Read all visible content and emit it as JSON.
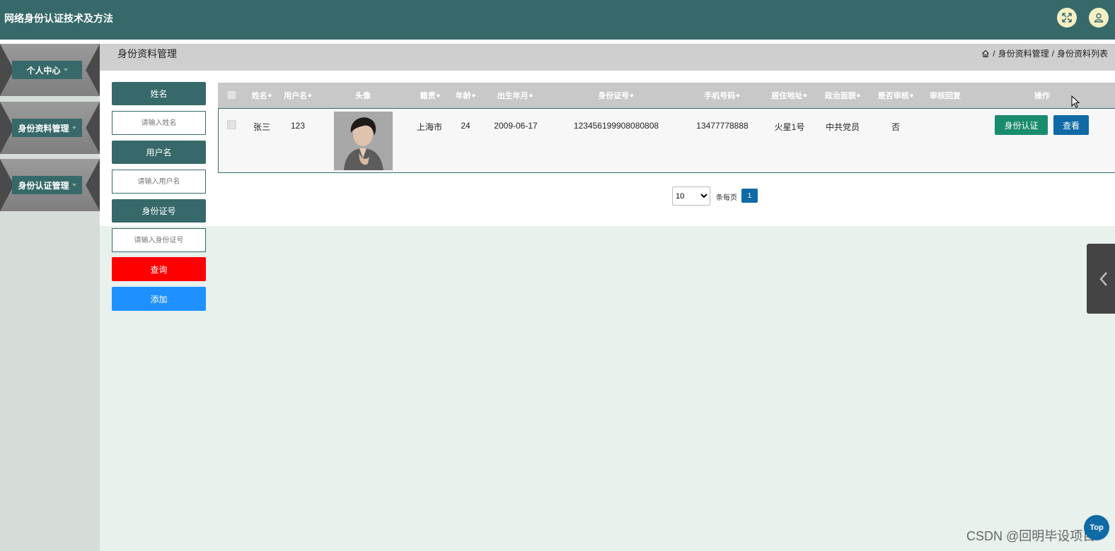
{
  "header": {
    "title": "网络身份认证技术及方法",
    "colors": {
      "bar": "#37696a",
      "button": "#f4f0c4"
    }
  },
  "sidebar": {
    "items": [
      {
        "label": "个人中心"
      },
      {
        "label": "身份资料管理"
      },
      {
        "label": "身份认证管理"
      }
    ]
  },
  "breadcrumb": {
    "title": "身份资料管理",
    "sep": "/",
    "path": [
      "身份资料管理",
      "身份资料列表"
    ]
  },
  "search": {
    "name_label": "姓名",
    "name_placeholder": "请输入姓名",
    "username_label": "用户名",
    "username_placeholder": "请输入用户名",
    "idnum_label": "身份证号",
    "idnum_placeholder": "请输入身份证号",
    "query_button": "查询",
    "add_button": "添加",
    "colors": {
      "query": "#ff0000",
      "add": "#1e90ff"
    }
  },
  "table": {
    "columns": [
      "姓名",
      "用户名",
      "头像",
      "籍贯",
      "年龄",
      "出生年月",
      "身份证号",
      "手机号码",
      "居住地址",
      "政治面貌",
      "是否审核",
      "审核回复",
      "操作"
    ],
    "rows": [
      {
        "name": "张三",
        "username": "123",
        "hometown": "上海市",
        "age": "24",
        "birth": "2009-06-17",
        "idnum": "123456199908080808",
        "phone": "13477778888",
        "address": "火星1号",
        "political": "中共党员",
        "reviewed": "否",
        "reply": "",
        "verify_button": "身份认证",
        "view_button": "查看"
      }
    ]
  },
  "pagination": {
    "page_size": "10",
    "per_page_label": "条每页",
    "current_page": "1"
  },
  "top_button": "Top",
  "watermark": "CSDN @回明毕设项目"
}
